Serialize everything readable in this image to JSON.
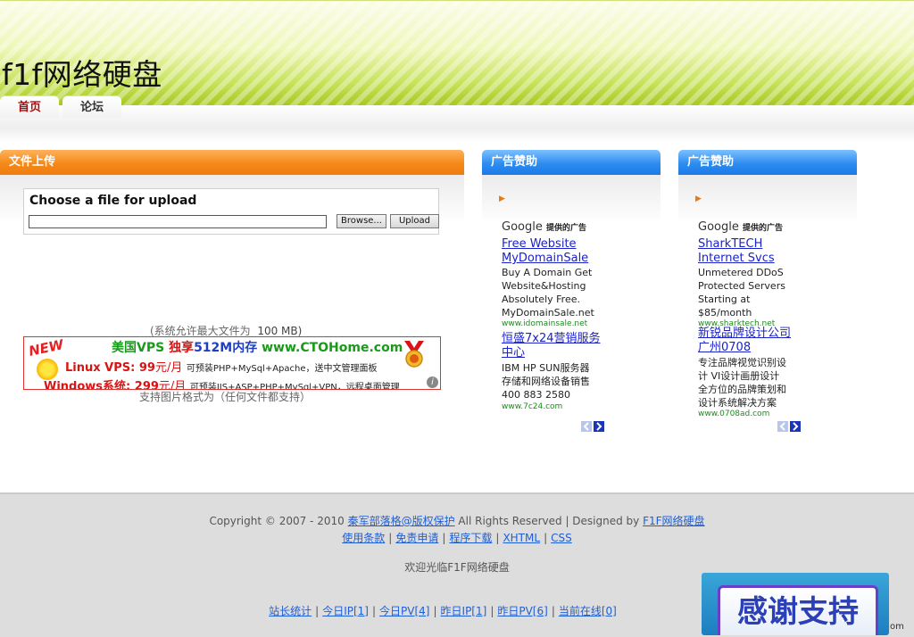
{
  "header": {
    "site_title": "f1f网络硬盘"
  },
  "nav": {
    "tabs": [
      {
        "label": "首页",
        "active": true
      },
      {
        "label": "论坛",
        "active": false
      }
    ]
  },
  "upload_panel": {
    "title": "文件上传",
    "form_title": "Choose a file for upload",
    "browse_label": "Browse...",
    "upload_label": "Upload",
    "max_size_note": "(系统允许最大文件为",
    "max_size_value": "100 MB)",
    "format_note": "支持图片格式为（任何文件都支持）"
  },
  "banner": {
    "new_label": "NEW",
    "line1_a": "美国VPS",
    "line1_b": "独享",
    "line1_c": "512M内存",
    "line1_d": "www.CTOHome.com",
    "line2_a": "Linux VPS: 99",
    "line2_b": "元/月",
    "line2_c": "可预装PHP+MySql+Apache，送中文管理面板",
    "line3_a": "Windows",
    "line3_b": "系统: 299",
    "line3_c": "元/月",
    "line3_d": "可预装IIS+ASP+PHP+MySql+VPN，远程桌面管理",
    "info_icon": "i"
  },
  "ad_panels": [
    {
      "title": "广告赞助",
      "google_label": "Google",
      "google_sub": "提供的广告",
      "ad1": {
        "link_line1": "Free Website",
        "link_line2": "MyDomainSale",
        "text": [
          "Buy A Domain Get",
          "Website&Hosting",
          "Absolutely Free.",
          "MyDomainSale.net"
        ],
        "url": "www.idomainsale.net"
      },
      "ad2": {
        "link_line1": "恒盛7x24营销服务",
        "link_line2": "中心",
        "text": [
          "IBM HP SUN服务器",
          "存储和网络设备销售",
          "400 883 2580"
        ],
        "url": "www.7c24.com"
      }
    },
    {
      "title": "广告赞助",
      "google_label": "Google",
      "google_sub": "提供的广告",
      "ad1": {
        "link_line1": "SharkTECH",
        "link_line2": "Internet Svcs",
        "text": [
          "Unmetered DDoS",
          "Protected Servers",
          "Starting at",
          "$85/month"
        ],
        "url": "www.sharktech.net"
      },
      "ad2": {
        "link_line1": "新锐品牌设计公司",
        "link_line2": "广州0708",
        "text": [
          "专注品牌视觉识别设",
          "计 VI设计画册设计",
          "全方位的品牌策划和",
          "设计系统解决方案"
        ],
        "url": "www.0708ad.com"
      }
    }
  ],
  "footer": {
    "copyright_pre": "Copyright © 2007 - 2010",
    "copyright_link": "秦军部落格@版权保护",
    "rights": "All Rights Reserved | Designed by",
    "designer_link": "F1F网络硬盘",
    "links": [
      "使用条款",
      "免责申请",
      "程序下载",
      "XHTML",
      "CSS"
    ],
    "welcome": "欢迎光临F1F网络硬盘",
    "stats": [
      "站长统计",
      "今日IP[1]",
      "今日PV[4]",
      "昨日IP[1]",
      "昨日PV[6]",
      "当前在线[0]"
    ],
    "thanks_label": "感谢支持",
    "edge_text": "om"
  },
  "colors": {
    "header_green": "#a6c81e",
    "orange": "#f5891a",
    "blue": "#2e8df0",
    "link": "#1a23c7"
  }
}
